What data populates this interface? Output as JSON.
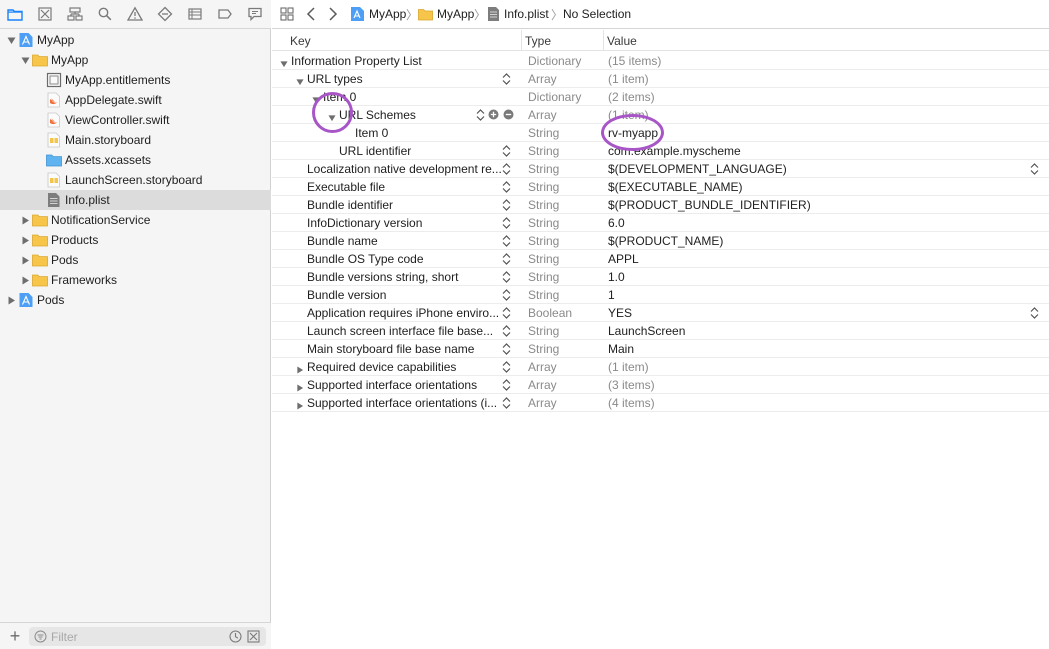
{
  "navigator": {
    "toolbar_icons": [
      "folder-icon",
      "source-control-icon",
      "hierarchy-icon",
      "search-icon",
      "warning-icon",
      "test-icon",
      "debug-icon",
      "breakpoint-icon",
      "report-icon"
    ],
    "tree": [
      {
        "label": "MyApp",
        "icon": "project-icon",
        "indent": 0,
        "expanded": true
      },
      {
        "label": "MyApp",
        "icon": "group-folder-icon",
        "indent": 1,
        "expanded": true
      },
      {
        "label": "MyApp.entitlements",
        "icon": "entitlements-file-icon",
        "indent": 2
      },
      {
        "label": "AppDelegate.swift",
        "icon": "swift-file-icon",
        "indent": 2
      },
      {
        "label": "ViewController.swift",
        "icon": "swift-file-icon",
        "indent": 2
      },
      {
        "label": "Main.storyboard",
        "icon": "storyboard-file-icon",
        "indent": 2
      },
      {
        "label": "Assets.xcassets",
        "icon": "assets-folder-icon",
        "indent": 2
      },
      {
        "label": "LaunchScreen.storyboard",
        "icon": "storyboard-file-icon",
        "indent": 2
      },
      {
        "label": "Info.plist",
        "icon": "plist-file-icon",
        "indent": 2,
        "selected": true
      },
      {
        "label": "NotificationService",
        "icon": "group-folder-icon",
        "indent": 1,
        "expanded": false
      },
      {
        "label": "Products",
        "icon": "group-folder-icon",
        "indent": 1,
        "expanded": false
      },
      {
        "label": "Pods",
        "icon": "group-folder-icon",
        "indent": 1,
        "expanded": false
      },
      {
        "label": "Frameworks",
        "icon": "group-folder-icon",
        "indent": 1,
        "expanded": false
      },
      {
        "label": "Pods",
        "icon": "project-icon",
        "indent": 0,
        "expanded": false
      }
    ],
    "footer": {
      "add_label": "+",
      "filter_placeholder": "Filter"
    }
  },
  "jumpbar": {
    "crumbs": [
      "MyApp",
      "MyApp",
      "Info.plist",
      "No Selection"
    ],
    "separator": "〉"
  },
  "editor": {
    "columns": {
      "key": "Key",
      "type": "Type",
      "value": "Value"
    },
    "rows": [
      {
        "key": "Information Property List",
        "type": "Dictionary",
        "value": "(15 items)",
        "level": 0,
        "disclosure": "open",
        "dim": true
      },
      {
        "key": "URL types",
        "type": "Array",
        "value": "(1 item)",
        "level": 1,
        "disclosure": "open",
        "dim": true,
        "stepper": true
      },
      {
        "key": "Item 0",
        "type": "Dictionary",
        "value": "(2 items)",
        "level": 2,
        "disclosure": "open",
        "dim": true
      },
      {
        "key": "URL Schemes",
        "type": "Array",
        "value": "(1 item)",
        "level": 3,
        "disclosure": "open",
        "dim": true,
        "stepper": true,
        "controls": true
      },
      {
        "key": "Item 0",
        "type": "String",
        "value": "rv-myapp",
        "level": 4
      },
      {
        "key": "URL identifier",
        "type": "String",
        "value": "com.example.myscheme",
        "level": 3,
        "stepper": true
      },
      {
        "key": "Localization native development re...",
        "type": "String",
        "value": "$(DEVELOPMENT_LANGUAGE)",
        "level": 1,
        "stepper": true,
        "value_stepper": true
      },
      {
        "key": "Executable file",
        "type": "String",
        "value": "$(EXECUTABLE_NAME)",
        "level": 1,
        "stepper": true
      },
      {
        "key": "Bundle identifier",
        "type": "String",
        "value": "$(PRODUCT_BUNDLE_IDENTIFIER)",
        "level": 1,
        "stepper": true
      },
      {
        "key": "InfoDictionary version",
        "type": "String",
        "value": "6.0",
        "level": 1,
        "stepper": true
      },
      {
        "key": "Bundle name",
        "type": "String",
        "value": "$(PRODUCT_NAME)",
        "level": 1,
        "stepper": true
      },
      {
        "key": "Bundle OS Type code",
        "type": "String",
        "value": "APPL",
        "level": 1,
        "stepper": true
      },
      {
        "key": "Bundle versions string, short",
        "type": "String",
        "value": "1.0",
        "level": 1,
        "stepper": true
      },
      {
        "key": "Bundle version",
        "type": "String",
        "value": "1",
        "level": 1,
        "stepper": true
      },
      {
        "key": "Application requires iPhone enviro...",
        "type": "Boolean",
        "value": "YES",
        "level": 1,
        "stepper": true,
        "value_stepper": true
      },
      {
        "key": "Launch screen interface file base...",
        "type": "String",
        "value": "LaunchScreen",
        "level": 1,
        "stepper": true
      },
      {
        "key": "Main storyboard file base name",
        "type": "String",
        "value": "Main",
        "level": 1,
        "stepper": true
      },
      {
        "key": "Required device capabilities",
        "type": "Array",
        "value": "(1 item)",
        "level": 1,
        "disclosure": "closed",
        "dim": true,
        "stepper": true
      },
      {
        "key": "Supported interface orientations",
        "type": "Array",
        "value": "(3 items)",
        "level": 1,
        "disclosure": "closed",
        "dim": true,
        "stepper": true
      },
      {
        "key": "Supported interface orientations (i...",
        "type": "Array",
        "value": "(4 items)",
        "level": 1,
        "disclosure": "closed",
        "dim": true,
        "stepper": true
      }
    ]
  },
  "colors": {
    "accent": "#1a82fb",
    "annotation": "#a855c7",
    "folder": "#f6c54a"
  }
}
